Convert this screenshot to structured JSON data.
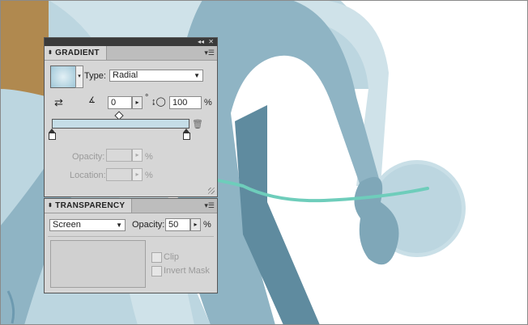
{
  "gradient_panel": {
    "title": "GRADIENT",
    "type_label": "Type:",
    "type_value": "Radial",
    "angle_value": "0",
    "degree_symbol": "°",
    "aspect_value": "100",
    "aspect_unit": "%",
    "opacity_label": "Opacity:",
    "opacity_unit": "%",
    "location_label": "Location:",
    "location_unit": "%"
  },
  "transparency_panel": {
    "title": "TRANSPARENCY",
    "blend_mode": "Screen",
    "opacity_label": "Opacity:",
    "opacity_value": "50",
    "opacity_unit": "%",
    "clip_label": "Clip",
    "invert_mask_label": "Invert Mask"
  },
  "colors": {
    "arrow": "#6ecdbb",
    "shape_light": "#bcd6e0",
    "shape_mid": "#8fb4c4",
    "shape_dark": "#5f8b9f",
    "accent_brown": "#b0894f",
    "panel_bg": "#d6d6d6"
  }
}
